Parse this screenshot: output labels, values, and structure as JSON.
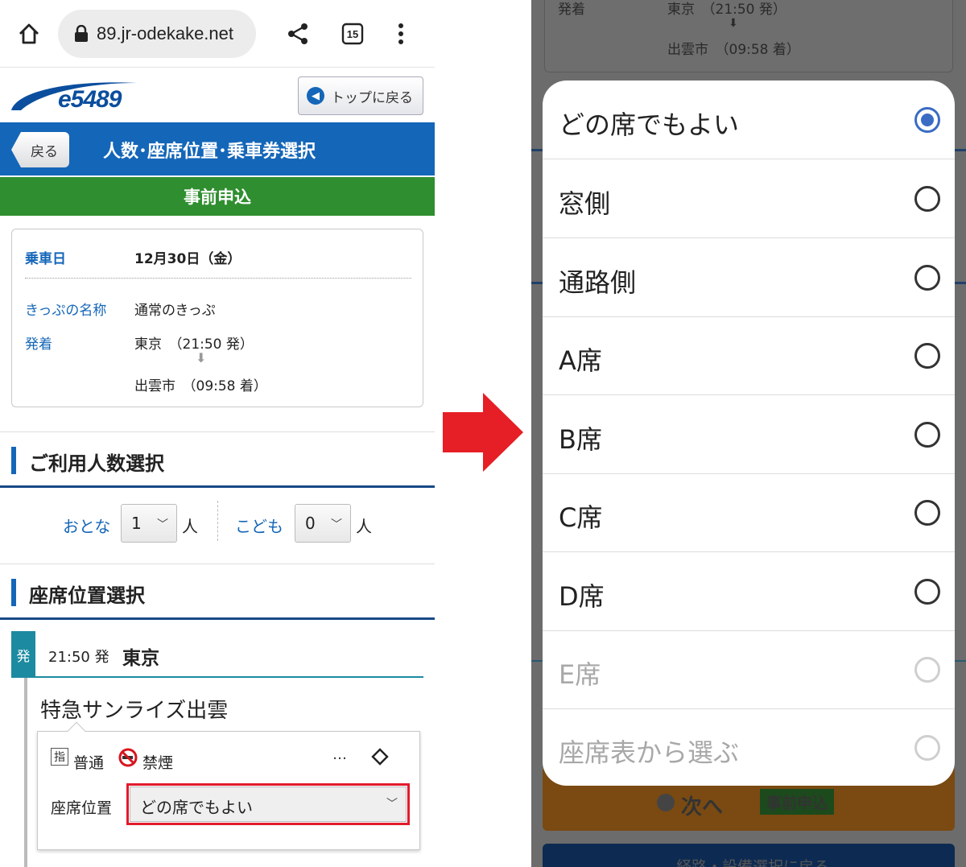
{
  "browser": {
    "url": "89.jr-odekake.net",
    "tab_count": "15"
  },
  "site": {
    "logo_text": "e5489",
    "top_button_label": "トップに戻る",
    "back_button_label": "戻る",
    "page_title": "人数･座席位置･乗車券選択",
    "pre_application": "事前申込"
  },
  "journey": {
    "date_label": "乗車日",
    "date_value": "12月30日（金）",
    "ticket_label": "きっぷの名称",
    "ticket_value": "通常のきっぷ",
    "route_label": "発着",
    "from": "東京　（21:50 発）",
    "to": "出雲市　（09:58 着）"
  },
  "passengers": {
    "section_title": "ご利用人数選択",
    "adult_label": "おとな",
    "adult_value": "1",
    "child_label": "こども",
    "child_value": "0",
    "unit": "人"
  },
  "seat": {
    "section_title": "座席位置選択",
    "dep_badge": "発",
    "dep_time": "21:50 発",
    "dep_station": "東京",
    "train_name": "特急サンライズ出雲",
    "reserved_icon": "指",
    "class_label": "普通",
    "smoking_label": "禁煙",
    "more_label": "…",
    "position_label": "座席位置",
    "position_value": "どの席でもよい"
  },
  "background": {
    "route_label": "発着",
    "from": "東京　（21:50 発）",
    "to": "出雲市　（09:58 着）",
    "next_label": "次へ",
    "next_badge": "事前申込",
    "back_label": "経路・設備選択に戻る"
  },
  "dialog": {
    "options": [
      {
        "label": "どの席でもよい",
        "checked": true,
        "enabled": true
      },
      {
        "label": "窓側",
        "checked": false,
        "enabled": true
      },
      {
        "label": "通路側",
        "checked": false,
        "enabled": true
      },
      {
        "label": "A席",
        "checked": false,
        "enabled": true
      },
      {
        "label": "B席",
        "checked": false,
        "enabled": true
      },
      {
        "label": "C席",
        "checked": false,
        "enabled": true
      },
      {
        "label": "D席",
        "checked": false,
        "enabled": true
      },
      {
        "label": "E席",
        "checked": false,
        "enabled": false
      },
      {
        "label": "座席表から選ぶ",
        "checked": false,
        "enabled": false
      }
    ]
  },
  "colors": {
    "primary_blue": "#1466b8",
    "green": "#2f8e2f",
    "highlight_red": "#e21b2c",
    "arrow_red": "#e61e25",
    "radio_selected": "#3a6cc4"
  }
}
